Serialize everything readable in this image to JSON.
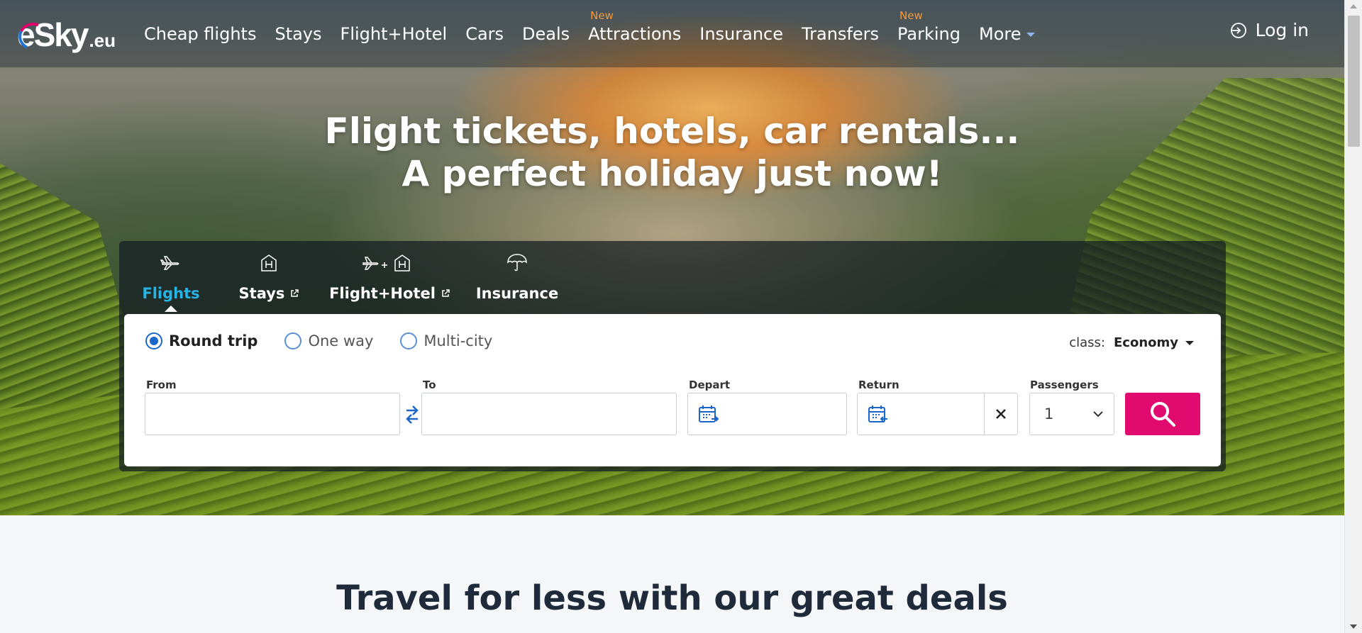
{
  "brand": {
    "logo_main": "eSky",
    "logo_suffix": ".eu"
  },
  "nav": {
    "items": [
      {
        "label": "Cheap flights",
        "badge": ""
      },
      {
        "label": "Stays",
        "badge": ""
      },
      {
        "label": "Flight+Hotel",
        "badge": ""
      },
      {
        "label": "Cars",
        "badge": ""
      },
      {
        "label": "Deals",
        "badge": ""
      },
      {
        "label": "Attractions",
        "badge": "New"
      },
      {
        "label": "Insurance",
        "badge": ""
      },
      {
        "label": "Transfers",
        "badge": ""
      },
      {
        "label": "Parking",
        "badge": "New"
      },
      {
        "label": "More",
        "badge": ""
      }
    ],
    "login_label": "Log in"
  },
  "hero": {
    "headline_line1": "Flight tickets, hotels, car rentals...",
    "headline_line2": "A perfect holiday just now!"
  },
  "search": {
    "tabs": [
      {
        "label": "Flights",
        "icon": "plane-icon",
        "active": true,
        "external": false
      },
      {
        "label": "Stays",
        "icon": "hotel-icon",
        "active": false,
        "external": true
      },
      {
        "label": "Flight+Hotel",
        "icon": "plane-hotel-icon",
        "active": false,
        "external": true
      },
      {
        "label": "Insurance",
        "icon": "umbrella-icon",
        "active": false,
        "external": false
      }
    ],
    "trip_types": [
      {
        "label": "Round trip",
        "checked": true
      },
      {
        "label": "One way",
        "checked": false
      },
      {
        "label": "Multi-city",
        "checked": false
      }
    ],
    "class_label": "class:",
    "class_value": "Economy",
    "fields": {
      "from_label": "From",
      "from_value": "",
      "to_label": "To",
      "to_value": "",
      "depart_label": "Depart",
      "depart_value": "",
      "return_label": "Return",
      "return_value": "",
      "passengers_label": "Passengers",
      "passengers_value": "1"
    }
  },
  "deals": {
    "title": "Travel for less with our great deals"
  },
  "colors": {
    "accent": "#27b3e6",
    "search_button": "#e10a6f",
    "radio": "#1a66c9",
    "badge_new": "#f29a3c"
  }
}
